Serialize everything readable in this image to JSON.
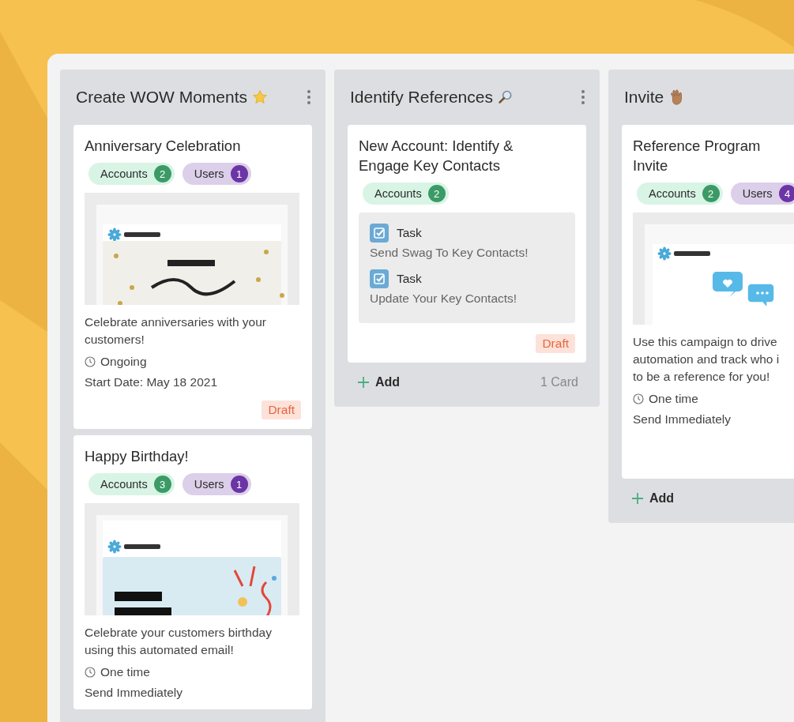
{
  "columns": [
    {
      "title": "Create WOW Moments",
      "menu": true,
      "cards": [
        {
          "title": "Anniversary Celebration",
          "tags": [
            {
              "kind": "accounts",
              "label": "Accounts",
              "count": "2"
            },
            {
              "kind": "users",
              "label": "Users",
              "count": "1"
            }
          ],
          "preview": {
            "kind": "anniversary"
          },
          "description": "Celebrate anniversaries with your customers!",
          "schedule": "Ongoing",
          "detail": "Start Date: May 18 2021",
          "status": "Draft"
        },
        {
          "title": "Happy Birthday!",
          "tags": [
            {
              "kind": "accounts",
              "label": "Accounts",
              "count": "3"
            },
            {
              "kind": "users",
              "label": "Users",
              "count": "1"
            }
          ],
          "preview": {
            "kind": "birthday"
          },
          "description": "Celebrate your customers birthday using this automated email!",
          "schedule": "One time",
          "detail": "Send Immediately"
        }
      ]
    },
    {
      "title": "Identify References",
      "menu": true,
      "cards": [
        {
          "title": "New Account: Identify & Engage Key Contacts",
          "tags": [
            {
              "kind": "accounts",
              "label": "Accounts",
              "count": "2"
            }
          ],
          "tasks": [
            {
              "label": "Task",
              "text": "Send Swag To Key Contacts!"
            },
            {
              "label": "Task",
              "text": "Update Your Key Contacts!"
            }
          ],
          "status": "Draft"
        }
      ],
      "footer": {
        "add": "Add",
        "count": "1 Card"
      }
    },
    {
      "title": "Invite",
      "menu": false,
      "cards": [
        {
          "title": "Reference Program Invite",
          "tags": [
            {
              "kind": "accounts",
              "label": "Accounts",
              "count": "2"
            },
            {
              "kind": "users",
              "label": "Users",
              "count": "4"
            }
          ],
          "preview": {
            "kind": "invite"
          },
          "description": "Use this campaign to drive automation and track who i to be a reference for you!",
          "schedule": "One time",
          "detail": "Send Immediately"
        }
      ],
      "footer": {
        "add": "Add"
      }
    }
  ]
}
